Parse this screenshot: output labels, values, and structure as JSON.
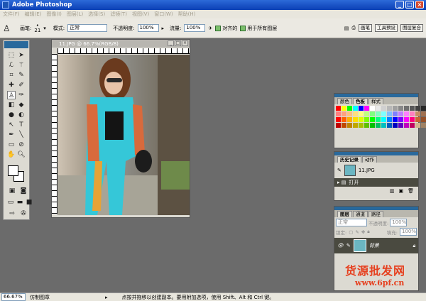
{
  "app": {
    "title": "Adobe Photoshop",
    "win_min": "_",
    "win_max": "□",
    "win_close": "×"
  },
  "menu": [
    "文件(F)",
    "编辑(E)",
    "图像(I)",
    "图层(L)",
    "选择(S)",
    "滤镜(T)",
    "视图(V)",
    "窗口(W)",
    "帮助(H)"
  ],
  "options": {
    "brush_label": "画笔:",
    "brush_size": "21",
    "mode_label": "模式:",
    "mode_value": "正常",
    "opacity_label": "不透明度:",
    "opacity_value": "100%",
    "flow_label": "流量:",
    "flow_value": "100%",
    "aligned_label": "对齐的",
    "all_layers_label": "用于所有图层",
    "well_brushes": "画笔",
    "well_presets": "工具预设",
    "well_comps": "图层复合"
  },
  "document": {
    "title": "11.JPG @ 66.7%(RGB/8)"
  },
  "swatches": {
    "tabs": [
      "颜色",
      "色板",
      "样式"
    ],
    "colors": [
      "#ff0000",
      "#ffff00",
      "#00ff00",
      "#00ffff",
      "#0000ff",
      "#ff00ff",
      "#ffffff",
      "#e8e8e8",
      "#d0d0d0",
      "#b8b8b8",
      "#a0a0a0",
      "#888888",
      "#707070",
      "#585858",
      "#404040",
      "#282828",
      "#101010",
      "#000000",
      "#ff7f7f",
      "#ff9f7f",
      "#ffbf7f",
      "#ffdf7f",
      "#ffff7f",
      "#bfff7f",
      "#7fff7f",
      "#7fffbf",
      "#7fffff",
      "#7fbfff",
      "#7f7fff",
      "#bf7fff",
      "#ff7fff",
      "#ff7fbf",
      "#c88c64",
      "#a07050",
      "#785038",
      "#503020",
      "#ff0000",
      "#ff5f00",
      "#ffaf00",
      "#ffdf00",
      "#dfff00",
      "#7fff00",
      "#00ff00",
      "#00ff7f",
      "#00ffff",
      "#007fff",
      "#0000ff",
      "#7f00ff",
      "#ff00ff",
      "#ff007f",
      "#c86432",
      "#965028",
      "#643c1e",
      "#322814",
      "#bf0000",
      "#bf4700",
      "#bf8300",
      "#bfa700",
      "#a7bf00",
      "#5fbf00",
      "#00bf00",
      "#00bf5f",
      "#00bfbf",
      "#005fbf",
      "#0000bf",
      "#5f00bf",
      "#bf00bf",
      "#bf005f",
      "#d2b48c",
      "#a08264",
      "#786450",
      "#504632",
      "#7f0000",
      "#7f2f00",
      "#7f5700",
      "#7f6f00",
      "#6f7f00",
      "#3f7f00",
      "#007f00",
      "#007f3f",
      "#007f7f",
      "#003f7f",
      "#00007f",
      "#3f007f",
      "#7f007f",
      "#7f003f",
      "#f0e6d2",
      "#c8b496",
      "#968264",
      "#64503c"
    ]
  },
  "history": {
    "tabs": [
      "历史记录",
      "动作"
    ],
    "snapshot": "11.JPG",
    "step": "打开"
  },
  "layers": {
    "tabs": [
      "图层",
      "通道",
      "路径"
    ],
    "mode": "正常",
    "opacity_label": "不透明度:",
    "opacity_value": "100%",
    "lock_label": "锁定:",
    "fill_label": "填充:",
    "fill_value": "100%",
    "layer_name": "背景"
  },
  "status": {
    "zoom": "66.67%",
    "doc_info": "仿制图章",
    "hint": "点按并拖移以创建副本。要用附加选项，使用 Shift、Alt 和 Ctrl 键。"
  },
  "watermark": {
    "line1": "货源批发网",
    "line2": "www.6pf.cn"
  }
}
